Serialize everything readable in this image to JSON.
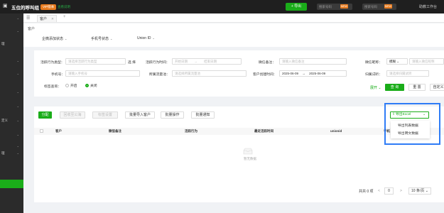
{
  "topbar": {
    "brand": "五位的呼叫组",
    "badge_orange": "VIP版本",
    "badge_green": "查看说明",
    "add_button": "+ 导出",
    "search_placeholder": "搜索号码",
    "search_badge": "NEW",
    "search2_placeholder": "搜索号码",
    "search2_badge": "NEW",
    "right_item": "助教工作台"
  },
  "sidebar": {
    "items": [
      {
        "label": "",
        "y": 0
      },
      {
        "label": "",
        "y": 1
      },
      {
        "label": "理",
        "y": 2
      },
      {
        "label": "",
        "y": 3
      },
      {
        "label": "",
        "y": 4
      },
      {
        "label": "",
        "y": 5
      },
      {
        "label": "",
        "y": 6
      },
      {
        "label": "定义",
        "y": 7
      },
      {
        "label": "",
        "y": 8
      },
      {
        "label": "",
        "y": 9
      },
      {
        "label": "理",
        "y": 10
      }
    ]
  },
  "tabs": {
    "items": [
      {
        "label": "客户"
      }
    ],
    "add": "+"
  },
  "header": {
    "breadcrumb": "客户",
    "filters": [
      "企微添加状态",
      "手机号状态",
      "Union ID"
    ]
  },
  "search": {
    "row1": {
      "label1": "活跃行为类型：",
      "ph1": "请选择活跃行为类型",
      "select_btn": "选 择",
      "label2": "活跃行为时间：",
      "ph2_start": "开始日期",
      "ph2_end": "结束日期",
      "label3": "微信备注：",
      "ph3": "请输入微信备注",
      "label4": "微信昵称：",
      "ph4_select": "模糊",
      "ph4": "请输入微信昵称"
    },
    "row2": {
      "label1": "手机号：",
      "ph1": "请输入手机号",
      "label2": "所属流量池：",
      "ph2": "请选择所属流量池",
      "label3": "客户创建时间：",
      "date_start": "2025-06-09",
      "date_end": "2025-06-09",
      "label4": "归属试听：",
      "ph4": "请选择归属试听"
    },
    "row3": {
      "label1": "标签查询：",
      "opt_on": "开启",
      "opt_off": "关闭",
      "expand": "展开",
      "query": "查 询",
      "reset": "重 置",
      "custom": "自定义"
    }
  },
  "toolbar": {
    "assign": "分配",
    "recycle": "回收至公海",
    "tag_set": "标签设置",
    "batch_import": "批量导入客户",
    "batch_op": "批量操作",
    "batch_notify": "批量通知"
  },
  "table": {
    "headers": [
      "客户",
      "微信备注",
      "活跃行为",
      "最近活跃时间",
      "unionid",
      "手机"
    ],
    "empty": "暂无数据"
  },
  "pagination": {
    "total": "共共 0 项",
    "prev": "<",
    "page": "0",
    "next": ">",
    "page_size": "10 条/页"
  },
  "export": {
    "button": "导出Excel",
    "items": [
      "导出列表数据",
      "导出明文数据"
    ]
  }
}
